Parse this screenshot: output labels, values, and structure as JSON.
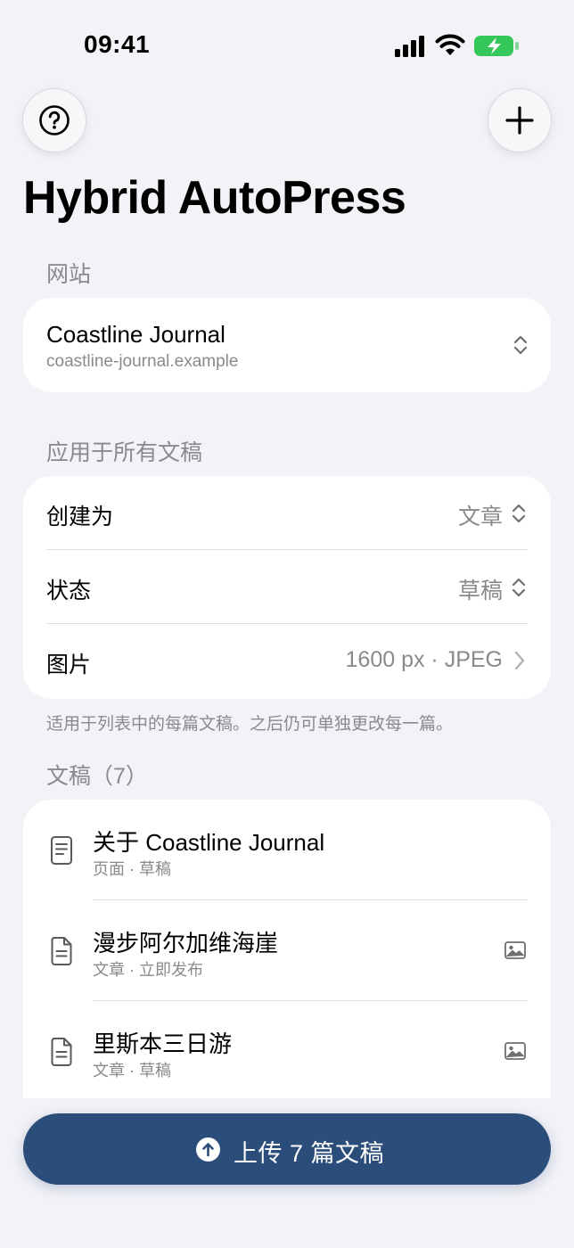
{
  "status_bar": {
    "time": "09:41"
  },
  "header": {
    "title": "Hybrid AutoPress"
  },
  "site_section": {
    "label": "网站",
    "site_name": "Coastline Journal",
    "site_url": "coastline-journal.example"
  },
  "apply_section": {
    "label": "应用于所有文稿",
    "rows": [
      {
        "label": "创建为",
        "value": "文章"
      },
      {
        "label": "状态",
        "value": "草稿"
      },
      {
        "label": "图片",
        "value": "1600 px · JPEG"
      }
    ],
    "footnote": "适用于列表中的每篇文稿。之后仍可单独更改每一篇。"
  },
  "docs_section": {
    "label": "文稿（7）",
    "items": [
      {
        "title": "关于 Coastline Journal",
        "subtitle": "页面 · 草稿",
        "icon": "page-icon",
        "has_image": false
      },
      {
        "title": "漫步阿尔加维海崖",
        "subtitle": "文章 · 立即发布",
        "icon": "post-icon",
        "has_image": true
      },
      {
        "title": "里斯本三日游",
        "subtitle": "文章 · 草稿",
        "icon": "post-icon",
        "has_image": true
      }
    ]
  },
  "upload_button": {
    "label": "上传 7 篇文稿"
  },
  "colors": {
    "accent": "#2a4d7a",
    "background": "#f2f2f7",
    "secondary_text": "#8a8a8e",
    "battery": "#34c759"
  }
}
